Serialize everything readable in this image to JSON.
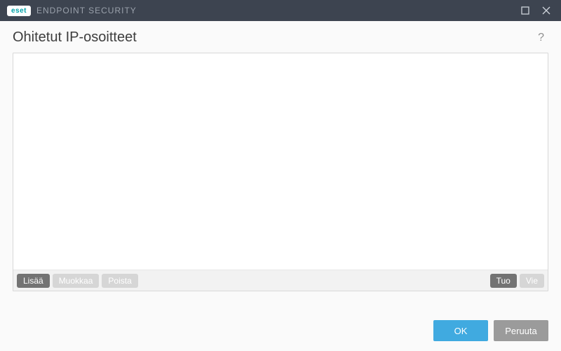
{
  "titlebar": {
    "brand": "eset",
    "product": "ENDPOINT SECURITY"
  },
  "page": {
    "title": "Ohitetut IP-osoitteet",
    "help": "?"
  },
  "toolbar": {
    "add": "Lisää",
    "edit": "Muokkaa",
    "delete": "Poista",
    "import": "Tuo",
    "export": "Vie"
  },
  "footer": {
    "ok": "OK",
    "cancel": "Peruuta"
  },
  "list": {
    "items": []
  }
}
